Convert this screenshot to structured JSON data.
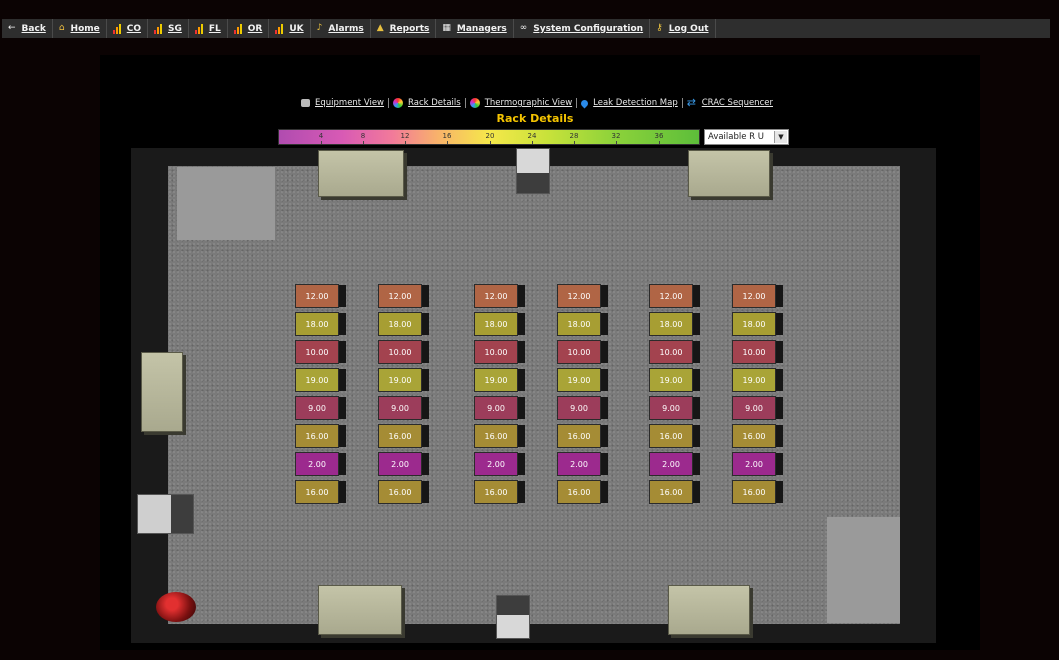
{
  "menu": [
    {
      "label": "Back",
      "icon": "back-arrow-icon"
    },
    {
      "label": "Home",
      "icon": "home-icon"
    },
    {
      "label": "CO",
      "icon": "bar-chart-icon"
    },
    {
      "label": "SG",
      "icon": "bar-chart-icon"
    },
    {
      "label": "FL",
      "icon": "bar-chart-icon"
    },
    {
      "label": "OR",
      "icon": "bar-chart-icon"
    },
    {
      "label": "UK",
      "icon": "bar-chart-icon"
    },
    {
      "label": "Alarms",
      "icon": "bell-icon"
    },
    {
      "label": "Reports",
      "icon": "reports-icon"
    },
    {
      "label": "Managers",
      "icon": "calendar-icon"
    },
    {
      "label": "System Configuration",
      "icon": "link-icon"
    },
    {
      "label": "Log Out",
      "icon": "key-icon"
    }
  ],
  "subnav": [
    {
      "label": "Equipment View",
      "icon": "equipment-icon"
    },
    {
      "label": "Rack Details",
      "icon": "color-wheel-icon"
    },
    {
      "label": "Thermographic View",
      "icon": "thermo-icon"
    },
    {
      "label": "Leak Detection Map",
      "icon": "water-drop-icon"
    },
    {
      "label": "CRAC Sequencer",
      "icon": "refresh-icon"
    }
  ],
  "page_title": "Rack Details",
  "scale_ticks": [
    "4",
    "8",
    "12",
    "16",
    "20",
    "24",
    "28",
    "32",
    "36"
  ],
  "metric_select": {
    "value": "Available R U"
  },
  "rack_values": [
    "12.00",
    "18.00",
    "10.00",
    "19.00",
    "9.00",
    "16.00",
    "2.00",
    "16.00"
  ],
  "colors": {
    "accent_title": "#f5c400",
    "menubar": "#2e2e2e"
  }
}
